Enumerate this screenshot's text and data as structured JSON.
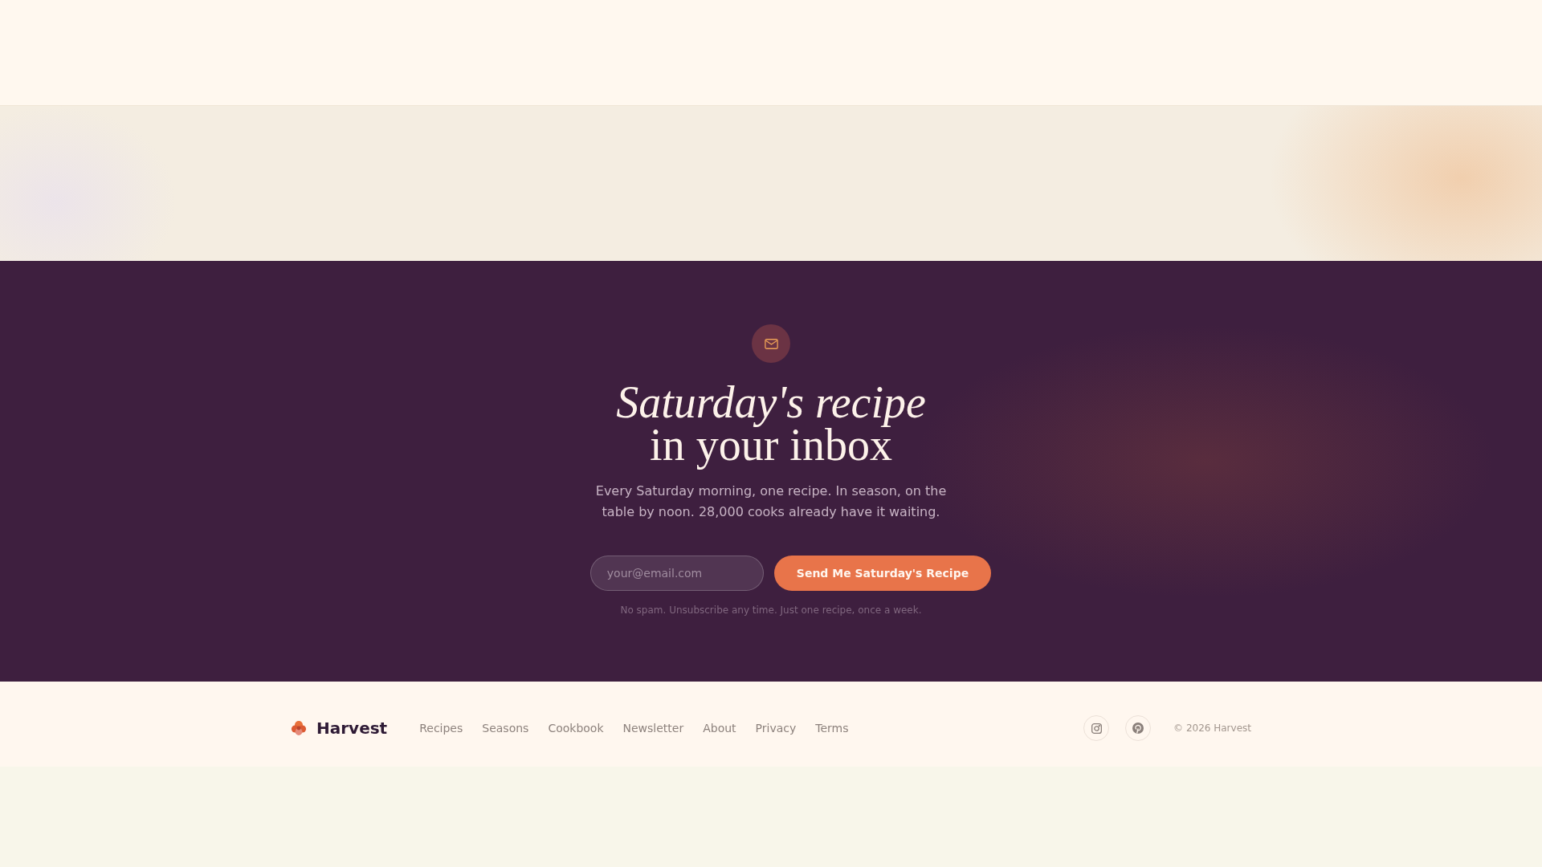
{
  "newsletter": {
    "heading": "*Saturday's recipe* in your inbox",
    "description": "Every Saturday morning, one recipe. In season, on the table by noon. 28,000 cooks already have it waiting.",
    "email_field": {
      "placeholder": "your@email.com"
    },
    "submit_button": "Send Me Saturday's Recipe",
    "note": "No spam. Unsubscribe any time. Just one recipe, once a week."
  },
  "footer": {
    "brand": "Harvest",
    "links": [
      "Recipes",
      "Seasons",
      "Cookbook",
      "Newsletter",
      "About",
      "Privacy",
      "Terms"
    ],
    "copyright": "© 2026 Harvest"
  }
}
